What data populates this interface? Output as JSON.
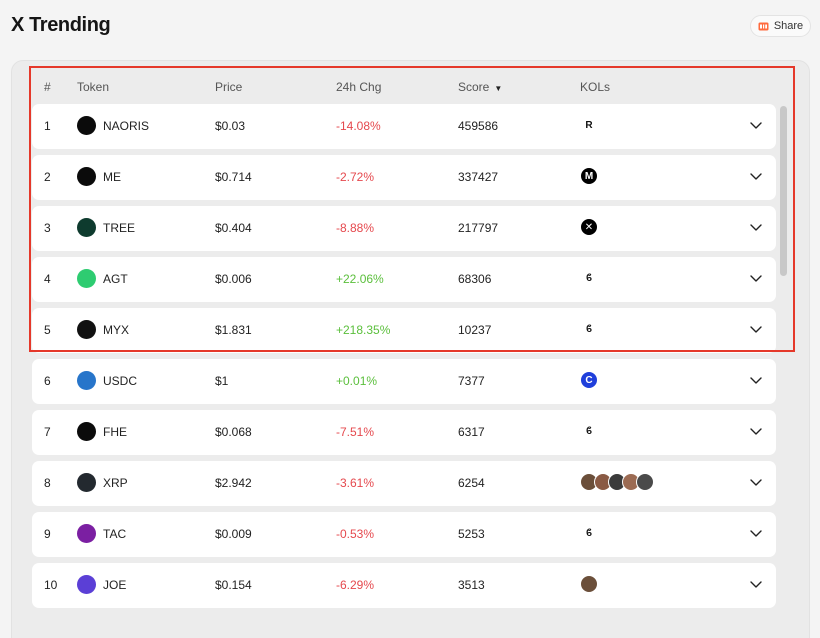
{
  "page": {
    "title": "X Trending"
  },
  "share": {
    "label": "Share",
    "icon": "share-icon",
    "accent": "#ff6a3d"
  },
  "table": {
    "headers": {
      "rank": "#",
      "token": "Token",
      "price": "Price",
      "change": "24h Chg",
      "score": "Score",
      "kols": "KOLs"
    },
    "sort": {
      "column": "score",
      "direction": "descending",
      "icon": "caret-down-icon"
    },
    "rows": [
      {
        "rank": "1",
        "token": "NAORIS",
        "price": "$0.03",
        "change": "-14.08%",
        "trend": "neg",
        "score": "459586",
        "kols": [
          "R"
        ],
        "logo_color": "#0b0b0b"
      },
      {
        "rank": "2",
        "token": "ME",
        "price": "$0.714",
        "change": "-2.72%",
        "trend": "neg",
        "score": "337427",
        "kols": [
          "M"
        ],
        "logo_color": "#0b0b0b"
      },
      {
        "rank": "3",
        "token": "TREE",
        "price": "$0.404",
        "change": "-8.88%",
        "trend": "neg",
        "score": "217797",
        "kols": [
          "✕"
        ],
        "logo_color": "#0e3b2e"
      },
      {
        "rank": "4",
        "token": "AGT",
        "price": "$0.006",
        "change": "+22.06%",
        "trend": "pos",
        "score": "68306",
        "kols": [
          "ϐ"
        ],
        "logo_color": "#2ecc71"
      },
      {
        "rank": "5",
        "token": "MYX",
        "price": "$1.831",
        "change": "+218.35%",
        "trend": "pos",
        "score": "10237",
        "kols": [
          "ϐ"
        ],
        "logo_color": "#111111"
      },
      {
        "rank": "6",
        "token": "USDC",
        "price": "$1",
        "change": "+0.01%",
        "trend": "pos",
        "score": "7377",
        "kols": [
          "C"
        ],
        "logo_color": "#2775ca"
      },
      {
        "rank": "7",
        "token": "FHE",
        "price": "$0.068",
        "change": "-7.51%",
        "trend": "neg",
        "score": "6317",
        "kols": [
          "ϐ"
        ],
        "logo_color": "#0b0b0b"
      },
      {
        "rank": "8",
        "token": "XRP",
        "price": "$2.942",
        "change": "-3.61%",
        "trend": "neg",
        "score": "6254",
        "kols": [
          "a",
          "b",
          "c",
          "d",
          "e"
        ],
        "logo_color": "#23292f"
      },
      {
        "rank": "9",
        "token": "TAC",
        "price": "$0.009",
        "change": "-0.53%",
        "trend": "neg",
        "score": "5253",
        "kols": [
          "ϐ"
        ],
        "logo_color": "#7b1fa2"
      },
      {
        "rank": "10",
        "token": "JOE",
        "price": "$0.154",
        "change": "-6.29%",
        "trend": "neg",
        "score": "3513",
        "kols": [
          "j"
        ],
        "logo_color": "#5b3fd6"
      }
    ]
  },
  "colors": {
    "negative": "#e5484d",
    "positive": "#5bbf3c",
    "highlight": "#e5382a"
  }
}
